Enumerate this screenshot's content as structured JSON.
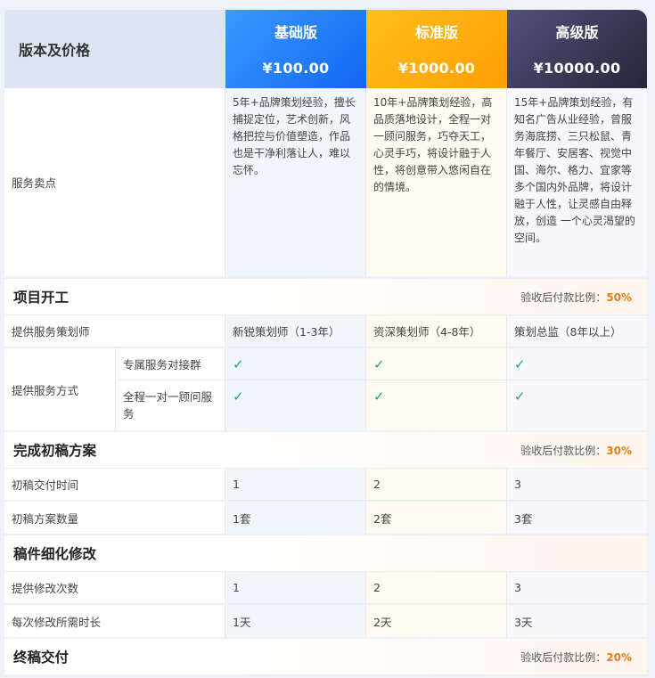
{
  "header": {
    "label": "版本及价格",
    "plans": [
      {
        "name": "基础版",
        "price": "¥100.00"
      },
      {
        "name": "标准版",
        "price": "¥1000.00"
      },
      {
        "name": "高级版",
        "price": "¥10000.00"
      }
    ]
  },
  "selling": {
    "label": "服务卖点",
    "basic": "5年+品牌策划经验，擅长捕捉定位，艺术创新，风格把控与价值塑造，作品也是干净利落让人，难以忘怀。",
    "standard": "10年+品牌策划经验，高品质落地设计，全程一对一顾问服务，巧夺天工，心灵手巧，将设计融于人性，将创意带入悠闲自在的情境。",
    "advanced": "15年+品牌策划经验，有知名广告从业经验，曾服务海底捞、三只松鼠、青年餐厅、安居客、视觉中国、海尔、格力、宜家等多个国内外品牌，将设计融于人性，让灵感自由释放，创造 一个心灵渴望的空间。"
  },
  "sections": {
    "kickoff": {
      "title": "项目开工",
      "ratio_label": "验收后付款比例：",
      "ratio": "50%"
    },
    "draft": {
      "title": "完成初稿方案",
      "ratio_label": "验收后付款比例：",
      "ratio": "30%"
    },
    "revise": {
      "title": "稿件细化修改"
    },
    "final": {
      "title": "终稿交付",
      "ratio_label": "验收后付款比例：",
      "ratio": "20%"
    }
  },
  "rows": {
    "planner": {
      "label": "提供服务策划师",
      "basic": "新锐策划师（1-3年）",
      "standard": "资深策划师（4-8年）",
      "advanced": "策划总监（8年以上）"
    },
    "method": {
      "label": "提供服务方式",
      "sub1": "专属服务对接群",
      "sub2": "全程一对一顾问服务",
      "check": "✓"
    },
    "draft_time": {
      "label": "初稿交付时间",
      "basic": "1",
      "standard": "2",
      "advanced": "3"
    },
    "draft_count": {
      "label": "初稿方案数量",
      "basic": "1套",
      "standard": "2套",
      "advanced": "3套"
    },
    "revise_count": {
      "label": "提供修改次数",
      "basic": "1",
      "standard": "2",
      "advanced": "3"
    },
    "revise_time": {
      "label": "每次修改所需时长",
      "basic": "1天",
      "standard": "2天",
      "advanced": "3天"
    }
  },
  "colors": {
    "accent_orange": "#f07d12",
    "check_green": "#19a974",
    "basic_blue": "#1366f2",
    "standard_gold": "#ff9d06",
    "advanced_dark": "#26263a"
  }
}
